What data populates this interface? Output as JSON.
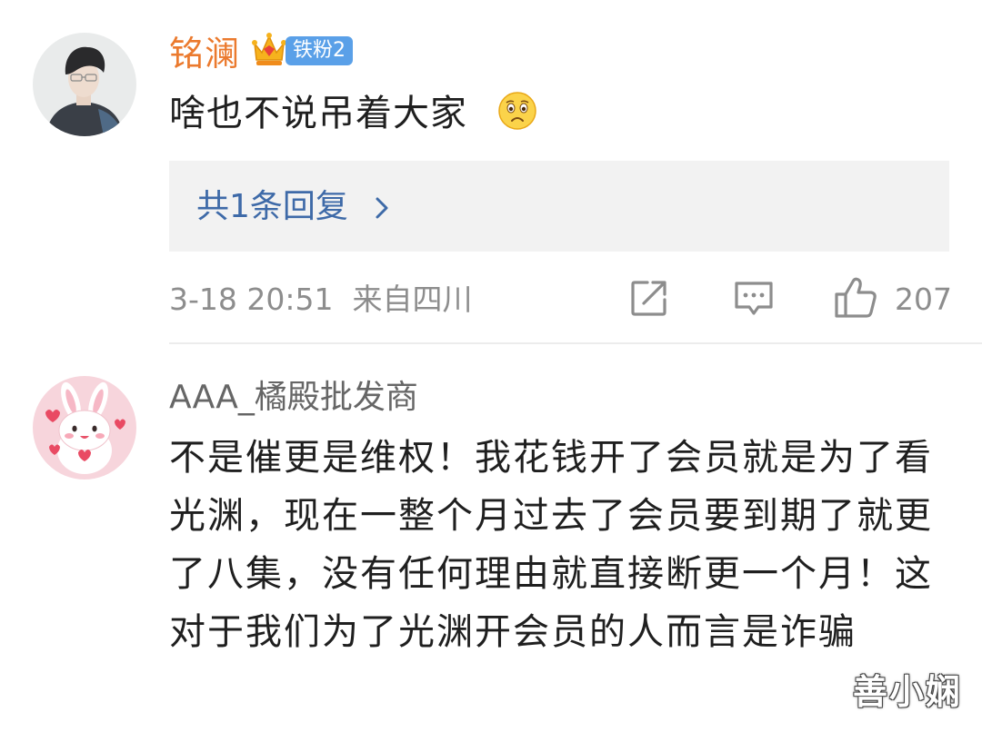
{
  "comments": [
    {
      "username": "铭澜",
      "fan_badge": "铁粉2",
      "text": "啥也不说吊着大家",
      "emoji_icon": "sad-face-emoji",
      "replies_label": "共1条回复",
      "timestamp": "3-18 20:51",
      "location": "来自四川",
      "likes": "207"
    },
    {
      "username": "AAA_橘殿批发商",
      "text": "不是催更是维权！我花钱开了会员就是为了看光渊，现在一整个月过去了会员要到期了就更了八集，没有任何理由就直接断更一个月！这对于我们为了光渊开会员的人而言是诈骗"
    }
  ],
  "meta": {
    "line1": "3-18 20:51  来自四川"
  },
  "watermark": "善小娴",
  "colors": {
    "username_highlight": "#eb7a2e",
    "fan_badge": "#5aa0e8",
    "reply_link": "#3e6aa8",
    "meta_gray": "#8d8d8d"
  }
}
